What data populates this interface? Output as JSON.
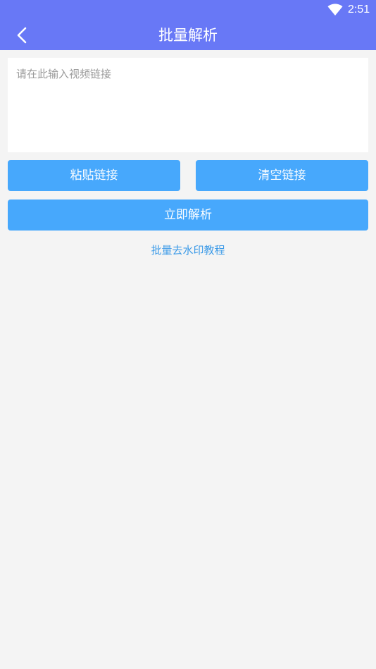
{
  "status_bar": {
    "time": "2:51",
    "wifi_icon": "wifi-icon"
  },
  "header": {
    "title": "批量解析",
    "back_icon": "back-arrow-icon",
    "background_color": "#6878f6"
  },
  "link_input": {
    "value": "",
    "placeholder": "请在此输入视频链接"
  },
  "actions": {
    "paste_label": "粘贴链接",
    "clear_label": "清空链接",
    "parse_label": "立即解析",
    "button_color": "#47a8fc"
  },
  "tutorial_link": {
    "label": "批量去水印教程",
    "color": "#3d9be8"
  }
}
